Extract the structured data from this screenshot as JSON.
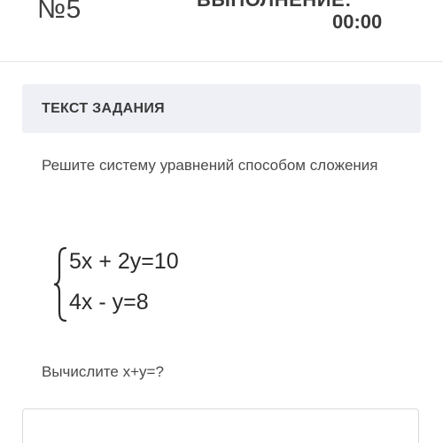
{
  "header": {
    "task_number": "№5",
    "timer_label": "ВЫПОЛНЕНИЕ:",
    "timer_value": "00:00"
  },
  "task": {
    "section_title": "ТЕКСТ ЗАДАНИЯ",
    "instruction": "Решите систему уравнений способом сложения",
    "equations": [
      "5x + 2y=10",
      "4x - y=8"
    ],
    "question": "Вычислите х+у=?"
  },
  "answer": {
    "value": "",
    "placeholder": ""
  },
  "icons": {
    "brace": "left-curly-brace"
  }
}
